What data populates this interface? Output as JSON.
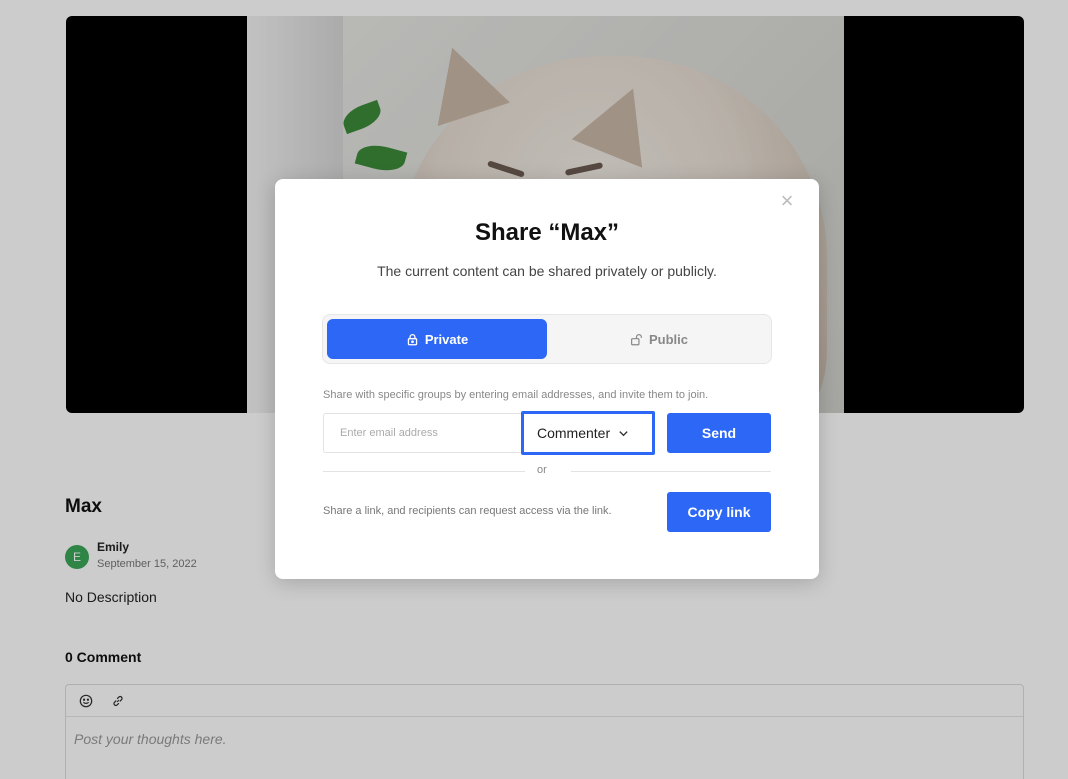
{
  "post": {
    "title": "Max",
    "author": {
      "initial": "E",
      "name": "Emily",
      "date": "September 15, 2022"
    },
    "description": "No Description"
  },
  "comments": {
    "count_label": "0 Comment",
    "placeholder": "Post your thoughts here.",
    "toolbar_icons": [
      "emoji-icon",
      "link-icon"
    ]
  },
  "share_modal": {
    "title": "Share “Max”",
    "subtitle": "The current content can be shared privately or publicly.",
    "tabs": {
      "private": "Private",
      "public": "Public",
      "active": "private"
    },
    "share_hint": "Share with specific groups by entering email addresses, and invite them to join.",
    "email_placeholder": "Enter email address",
    "role": "Commenter",
    "send_label": "Send",
    "or_label": "or",
    "link_hint": "Share a link, and recipients can request access via the link.",
    "copy_link_label": "Copy link"
  },
  "colors": {
    "accent": "#2d67f5",
    "avatar": "#3aa757"
  }
}
